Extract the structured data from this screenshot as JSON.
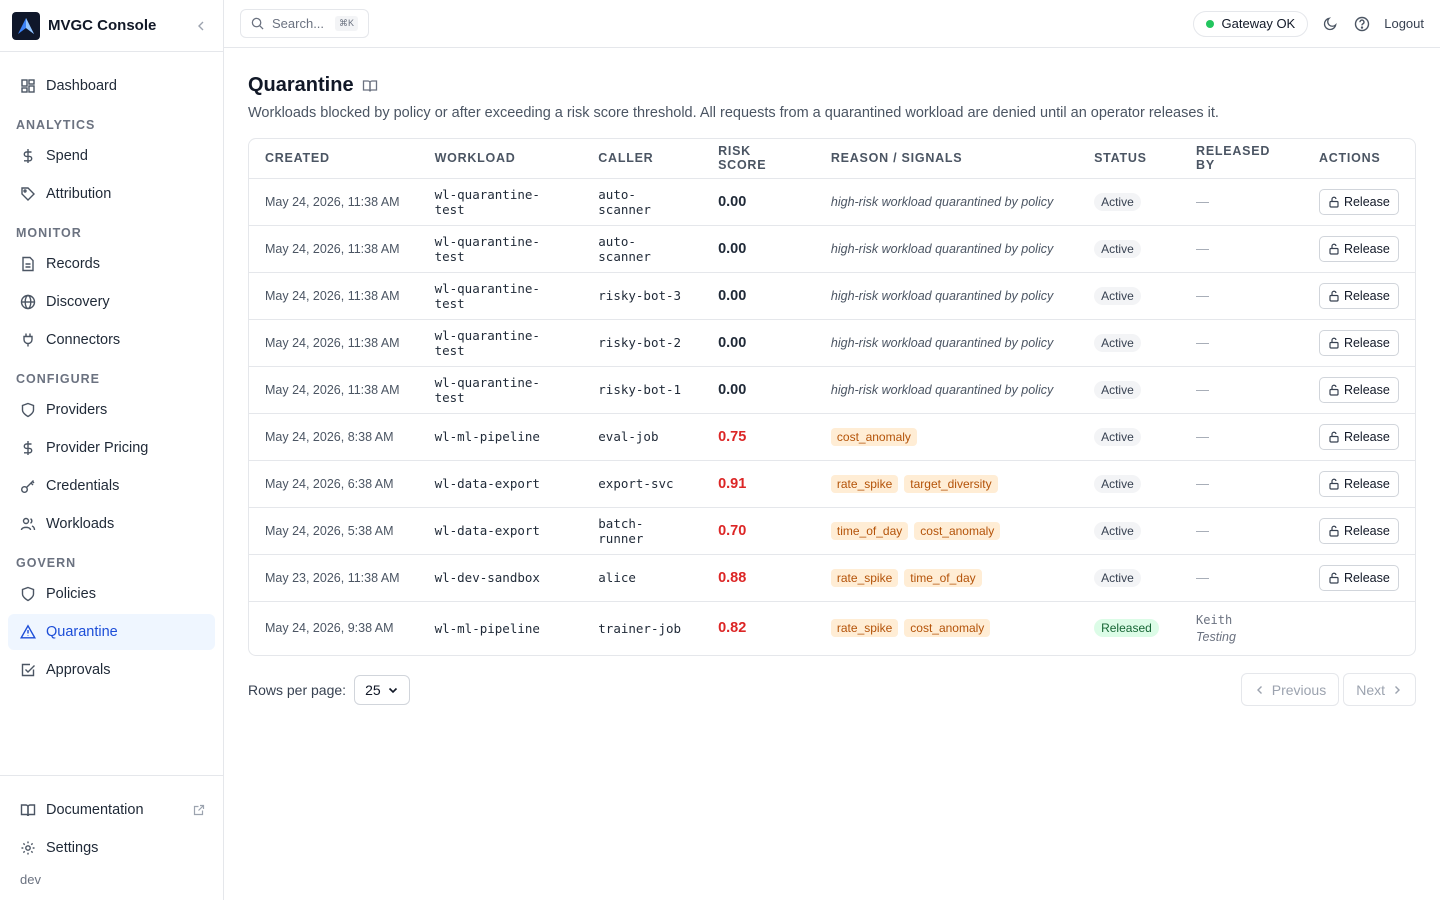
{
  "app": {
    "title": "MVGC Console"
  },
  "sidebar": {
    "dashboard": "Dashboard",
    "sections": {
      "analytics": "ANALYTICS",
      "monitor": "MONITOR",
      "configure": "CONFIGURE",
      "govern": "GOVERN"
    },
    "items": {
      "spend": "Spend",
      "attribution": "Attribution",
      "records": "Records",
      "discovery": "Discovery",
      "connectors": "Connectors",
      "providers": "Providers",
      "provider_pricing": "Provider Pricing",
      "credentials": "Credentials",
      "workloads": "Workloads",
      "policies": "Policies",
      "quarantine": "Quarantine",
      "approvals": "Approvals"
    },
    "bottom": {
      "documentation": "Documentation",
      "settings": "Settings",
      "env": "dev"
    }
  },
  "topbar": {
    "search_placeholder": "Search...",
    "search_shortcut": "⌘K",
    "gateway_status": "Gateway OK",
    "logout": "Logout"
  },
  "page": {
    "title": "Quarantine",
    "description": "Workloads blocked by policy or after exceeding a risk score threshold. All requests from a quarantined workload are denied until an operator releases it."
  },
  "table": {
    "columns": [
      "CREATED",
      "WORKLOAD",
      "CALLER",
      "RISK SCORE",
      "REASON / SIGNALS",
      "STATUS",
      "RELEASED BY",
      "ACTIONS"
    ],
    "rows": [
      {
        "created": "May 24, 2026, 11:38 AM",
        "workload": "wl-quarantine-test",
        "caller": "auto-scanner",
        "score": "0.00",
        "high": false,
        "reason": "high-risk workload quarantined by policy",
        "signals": [],
        "status": "Active",
        "released_by": "—",
        "released_note": "",
        "action": "Release"
      },
      {
        "created": "May 24, 2026, 11:38 AM",
        "workload": "wl-quarantine-test",
        "caller": "auto-scanner",
        "score": "0.00",
        "high": false,
        "reason": "high-risk workload quarantined by policy",
        "signals": [],
        "status": "Active",
        "released_by": "—",
        "released_note": "",
        "action": "Release"
      },
      {
        "created": "May 24, 2026, 11:38 AM",
        "workload": "wl-quarantine-test",
        "caller": "risky-bot-3",
        "score": "0.00",
        "high": false,
        "reason": "high-risk workload quarantined by policy",
        "signals": [],
        "status": "Active",
        "released_by": "—",
        "released_note": "",
        "action": "Release"
      },
      {
        "created": "May 24, 2026, 11:38 AM",
        "workload": "wl-quarantine-test",
        "caller": "risky-bot-2",
        "score": "0.00",
        "high": false,
        "reason": "high-risk workload quarantined by policy",
        "signals": [],
        "status": "Active",
        "released_by": "—",
        "released_note": "",
        "action": "Release"
      },
      {
        "created": "May 24, 2026, 11:38 AM",
        "workload": "wl-quarantine-test",
        "caller": "risky-bot-1",
        "score": "0.00",
        "high": false,
        "reason": "high-risk workload quarantined by policy",
        "signals": [],
        "status": "Active",
        "released_by": "—",
        "released_note": "",
        "action": "Release"
      },
      {
        "created": "May 24, 2026, 8:38 AM",
        "workload": "wl-ml-pipeline",
        "caller": "eval-job",
        "score": "0.75",
        "high": true,
        "reason": "",
        "signals": [
          "cost_anomaly"
        ],
        "status": "Active",
        "released_by": "—",
        "released_note": "",
        "action": "Release"
      },
      {
        "created": "May 24, 2026, 6:38 AM",
        "workload": "wl-data-export",
        "caller": "export-svc",
        "score": "0.91",
        "high": true,
        "reason": "",
        "signals": [
          "rate_spike",
          "target_diversity"
        ],
        "status": "Active",
        "released_by": "—",
        "released_note": "",
        "action": "Release"
      },
      {
        "created": "May 24, 2026, 5:38 AM",
        "workload": "wl-data-export",
        "caller": "batch-runner",
        "score": "0.70",
        "high": true,
        "reason": "",
        "signals": [
          "time_of_day",
          "cost_anomaly"
        ],
        "status": "Active",
        "released_by": "—",
        "released_note": "",
        "action": "Release"
      },
      {
        "created": "May 23, 2026, 11:38 AM",
        "workload": "wl-dev-sandbox",
        "caller": "alice",
        "score": "0.88",
        "high": true,
        "reason": "",
        "signals": [
          "rate_spike",
          "time_of_day"
        ],
        "status": "Active",
        "released_by": "—",
        "released_note": "",
        "action": "Release"
      },
      {
        "created": "May 24, 2026, 9:38 AM",
        "workload": "wl-ml-pipeline",
        "caller": "trainer-job",
        "score": "0.82",
        "high": true,
        "reason": "",
        "signals": [
          "rate_spike",
          "cost_anomaly"
        ],
        "status": "Released",
        "released_by": "Keith",
        "released_note": "Testing",
        "action": ""
      }
    ]
  },
  "pagination": {
    "rows_per_page_label": "Rows per page:",
    "rows_per_page": "25",
    "previous": "Previous",
    "next": "Next"
  },
  "colors": {
    "accent": "#1d4ed8",
    "danger": "#dc2626",
    "success": "#22c55e",
    "signal_bg": "#ffedd5",
    "signal_text": "#b45309"
  }
}
